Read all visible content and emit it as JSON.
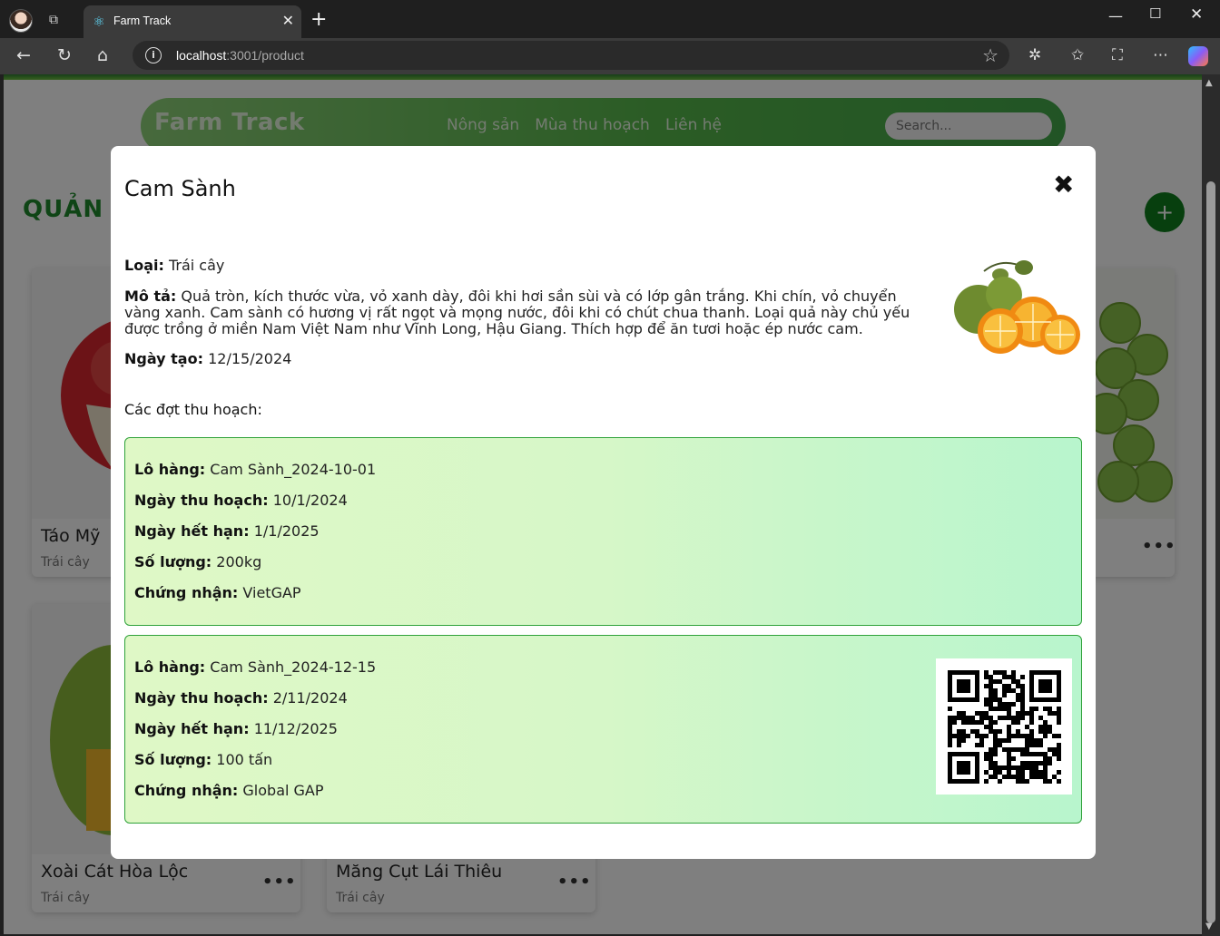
{
  "browser": {
    "tab_title": "Farm Track",
    "url_host": "localhost",
    "url_path": ":3001/product"
  },
  "navbar": {
    "logo": "Farm Track",
    "links": [
      "Nông sản",
      "Mùa thu hoạch",
      "Liên hệ"
    ],
    "search_placeholder": "Search..."
  },
  "page": {
    "heading_visible": "QUẢN L",
    "add_button": "+"
  },
  "cards": [
    {
      "name": "Táo Mỹ",
      "type": "Trái cây"
    },
    {
      "name": "Xoài Cát Hòa Lộc",
      "type": "Trái cây"
    },
    {
      "name": "Măng Cụt Lái Thiêu",
      "type": "Trái cây"
    }
  ],
  "modal": {
    "title": "Cam Sành",
    "close_icon": "✖",
    "type_label": "Loại:",
    "type_value": "Trái cây",
    "desc_label": "Mô tả:",
    "desc_value": "Quả tròn, kích thước vừa, vỏ xanh dày, đôi khi hơi sần sùi và có lớp gân trắng. Khi chín, vỏ chuyển vàng xanh. Cam sành có hương vị rất ngọt và mọng nước, đôi khi có chút chua thanh. Loại quả này chủ yếu được trồng ở miền Nam Việt Nam như Vĩnh Long, Hậu Giang. Thích hợp để ăn tươi hoặc ép nước cam.",
    "created_label": "Ngày tạo:",
    "created_value": "12/15/2024",
    "harvest_heading": "Các đợt thu hoạch:",
    "labels": {
      "lot": "Lô hàng:",
      "harvest_date": "Ngày thu hoạch:",
      "expiry": "Ngày hết hạn:",
      "quantity": "Số lượng:",
      "cert": "Chứng nhận:"
    },
    "batches": [
      {
        "lot": "Cam Sành_2024-10-01",
        "harvest_date": "10/1/2024",
        "expiry": "1/1/2025",
        "quantity": "200kg",
        "cert": "VietGAP"
      },
      {
        "lot": "Cam Sành_2024-12-15",
        "harvest_date": "2/11/2024",
        "expiry": "11/12/2025",
        "quantity": "100 tấn",
        "cert": "Global GAP"
      }
    ]
  }
}
